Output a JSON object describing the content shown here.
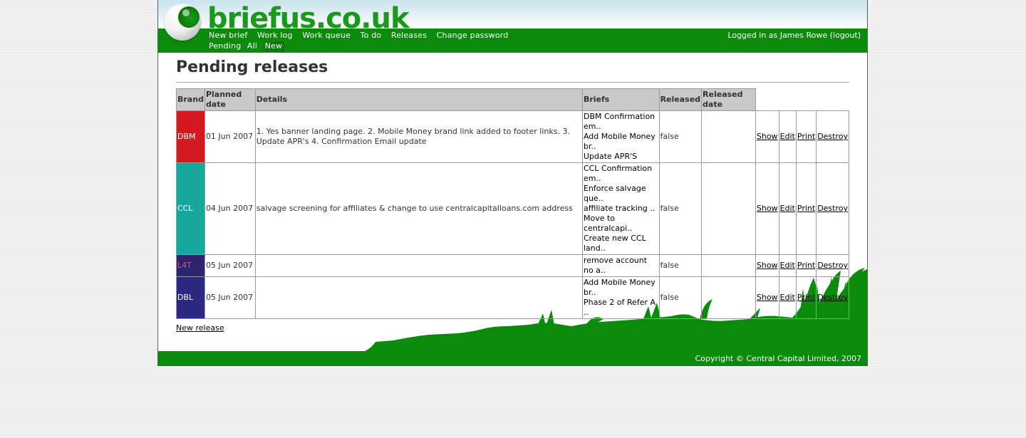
{
  "site": {
    "title": "briefus.co.uk"
  },
  "nav": {
    "main": [
      "New brief",
      "Work log",
      "Work queue",
      "To do",
      "Releases",
      "Change password"
    ],
    "sub": [
      "Pending",
      "All",
      "New"
    ]
  },
  "user": {
    "logged_in_text": "Logged in as James Rowe",
    "logout_label": "(logout)"
  },
  "page": {
    "title": "Pending releases"
  },
  "table": {
    "headers": {
      "brand": "Brand",
      "planned_date": "Planned date",
      "details": "Details",
      "briefs": "Briefs",
      "released": "Released",
      "released_date": "Released date"
    },
    "rows": [
      {
        "brand": "DBM",
        "brand_color": "#d41920",
        "text_color": "#ffffff",
        "planned_date": "01 Jun 2007",
        "details": "1. Yes banner landing page. 2. Mobile Money brand link added to footer links. 3. Update APR's 4. Confirmation Email update",
        "briefs": [
          "DBM Confirmation em..",
          "Add Mobile Money br..",
          "Update APR'S"
        ],
        "released": "false",
        "released_date": ""
      },
      {
        "brand": "CCL",
        "brand_color": "#17a89c",
        "text_color": "#ffffff",
        "planned_date": "04 Jun 2007",
        "details": "salvage screening for affiliates & change to use centralcapitalloans.com address",
        "briefs": [
          "CCL Confirmation em..",
          "Enforce salvage que..",
          "affiliate tracking ..",
          "Move to centralcapi..",
          "Create new CCL land.."
        ],
        "released": "false",
        "released_date": ""
      },
      {
        "brand": "L4T",
        "brand_color": "#2b2570",
        "text_color": "#e0506a",
        "planned_date": "05 Jun 2007",
        "details": "",
        "briefs": [
          "remove account no a.."
        ],
        "released": "false",
        "released_date": ""
      },
      {
        "brand": "DBL",
        "brand_color": "#2a2882",
        "text_color": "#ffffff",
        "planned_date": "05 Jun 2007",
        "details": "",
        "briefs": [
          "Add Mobile Money br..",
          "Phase 2 of Refer A .."
        ],
        "released": "false",
        "released_date": ""
      }
    ],
    "actions": {
      "show": "Show",
      "edit": "Edit",
      "print": "Print",
      "destroy": "Destroy"
    }
  },
  "links": {
    "new_release": "New release"
  },
  "footer": {
    "copyright": "Copyright © Central Capital Limited, 2007"
  },
  "colors": {
    "nav_green": "#0b8a0b",
    "title_green": "#1a9a1a",
    "header_gray": "#c9c9c9"
  }
}
